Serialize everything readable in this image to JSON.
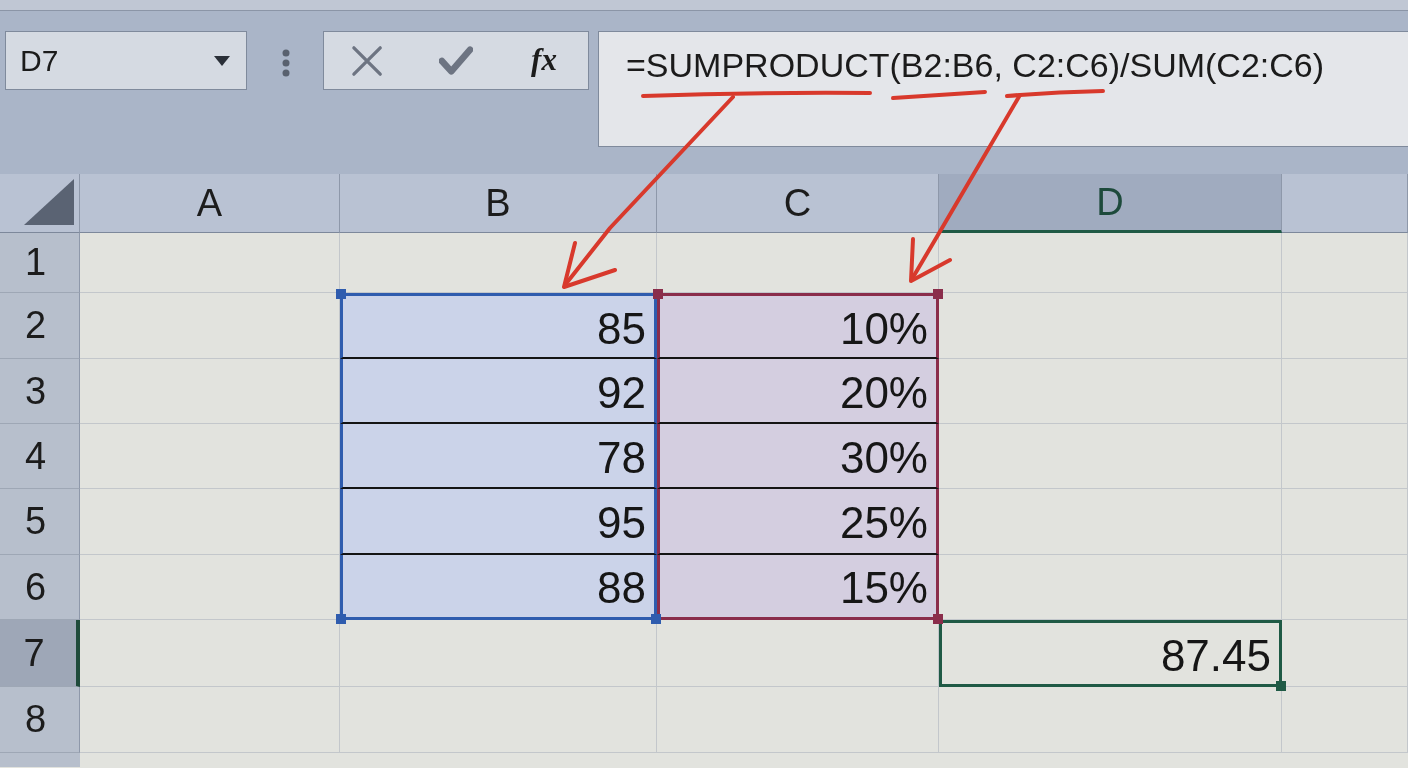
{
  "name_box": {
    "value": "D7"
  },
  "formula_buttons": [
    {
      "kind": "cancel",
      "disabled": true
    },
    {
      "kind": "enter",
      "disabled": true
    },
    {
      "kind": "function",
      "label": "fx",
      "disabled": false
    }
  ],
  "formula_bar": {
    "value": "=SUMPRODUCT(B2:B6, C2:C6)/SUM(C2:C6)"
  },
  "columns": [
    {
      "label": "A",
      "selected": false
    },
    {
      "label": "B",
      "selected": false
    },
    {
      "label": "C",
      "selected": false
    },
    {
      "label": "D",
      "selected": true
    },
    {
      "selected": false
    }
  ],
  "rows": [
    {
      "label": "1",
      "selected": false,
      "cells": [
        {
          "kind": "blank",
          "selected": false
        },
        {
          "kind": "blank",
          "selected": false
        },
        {
          "kind": "blank",
          "selected": false
        },
        {
          "kind": "blank",
          "selected": false
        },
        {
          "kind": "blank",
          "selected": false
        }
      ]
    },
    {
      "label": "2",
      "selected": false,
      "cells": [
        {
          "kind": "blank",
          "selected": false
        },
        {
          "kind": "value",
          "text": "85",
          "color": "#2f5cae",
          "selected": false
        },
        {
          "kind": "value",
          "text": "10%",
          "color": "#8a2d4b",
          "selected": false
        },
        {
          "kind": "blank",
          "selected": false
        },
        {
          "kind": "blank",
          "selected": false
        }
      ]
    },
    {
      "label": "3",
      "selected": false,
      "cells": [
        {
          "kind": "blank",
          "selected": false
        },
        {
          "kind": "value",
          "text": "92",
          "color": "#2f5cae",
          "selected": false
        },
        {
          "kind": "value",
          "text": "20%",
          "color": "#8a2d4b",
          "selected": false
        },
        {
          "kind": "blank",
          "selected": false
        },
        {
          "kind": "blank",
          "selected": false
        }
      ]
    },
    {
      "label": "4",
      "selected": false,
      "cells": [
        {
          "kind": "blank",
          "selected": false
        },
        {
          "kind": "value",
          "text": "78",
          "color": "#2f5cae",
          "selected": false
        },
        {
          "kind": "value",
          "text": "30%",
          "color": "#8a2d4b",
          "selected": false
        },
        {
          "kind": "blank",
          "selected": false
        },
        {
          "kind": "blank",
          "selected": false
        }
      ]
    },
    {
      "label": "5",
      "selected": false,
      "cells": [
        {
          "kind": "blank",
          "selected": false
        },
        {
          "kind": "value",
          "text": "95",
          "color": "#2f5cae",
          "selected": false
        },
        {
          "kind": "value",
          "text": "25%",
          "color": "#8a2d4b",
          "selected": false
        },
        {
          "kind": "blank",
          "selected": false
        },
        {
          "kind": "blank",
          "selected": false
        }
      ]
    },
    {
      "label": "6",
      "selected": false,
      "cells": [
        {
          "kind": "blank",
          "selected": false
        },
        {
          "kind": "value",
          "text": "88",
          "color": "#2f5cae",
          "selected": false
        },
        {
          "kind": "value",
          "text": "15%",
          "color": "#8a2d4b",
          "selected": false
        },
        {
          "kind": "blank",
          "selected": false
        },
        {
          "kind": "blank",
          "selected": false
        }
      ]
    },
    {
      "label": "7",
      "selected": true,
      "cells": [
        {
          "kind": "blank",
          "selected": false
        },
        {
          "kind": "blank",
          "selected": false
        },
        {
          "kind": "blank",
          "selected": false
        },
        {
          "kind": "value",
          "text": "87.45",
          "selected": true
        },
        {
          "kind": "blank",
          "selected": false
        }
      ]
    },
    {
      "label": "8",
      "selected": false,
      "cells": [
        {
          "kind": "blank",
          "selected": false
        },
        {
          "kind": "blank",
          "selected": false
        },
        {
          "kind": "blank",
          "selected": false
        },
        {
          "kind": "blank",
          "selected": false
        },
        {
          "kind": "blank",
          "selected": false
        }
      ]
    }
  ],
  "annotations": [
    {
      "kind": "underline"
    },
    {
      "kind": "underline"
    },
    {
      "kind": "underline"
    },
    {
      "kind": "arrow"
    },
    {
      "kind": "arrow"
    }
  ]
}
